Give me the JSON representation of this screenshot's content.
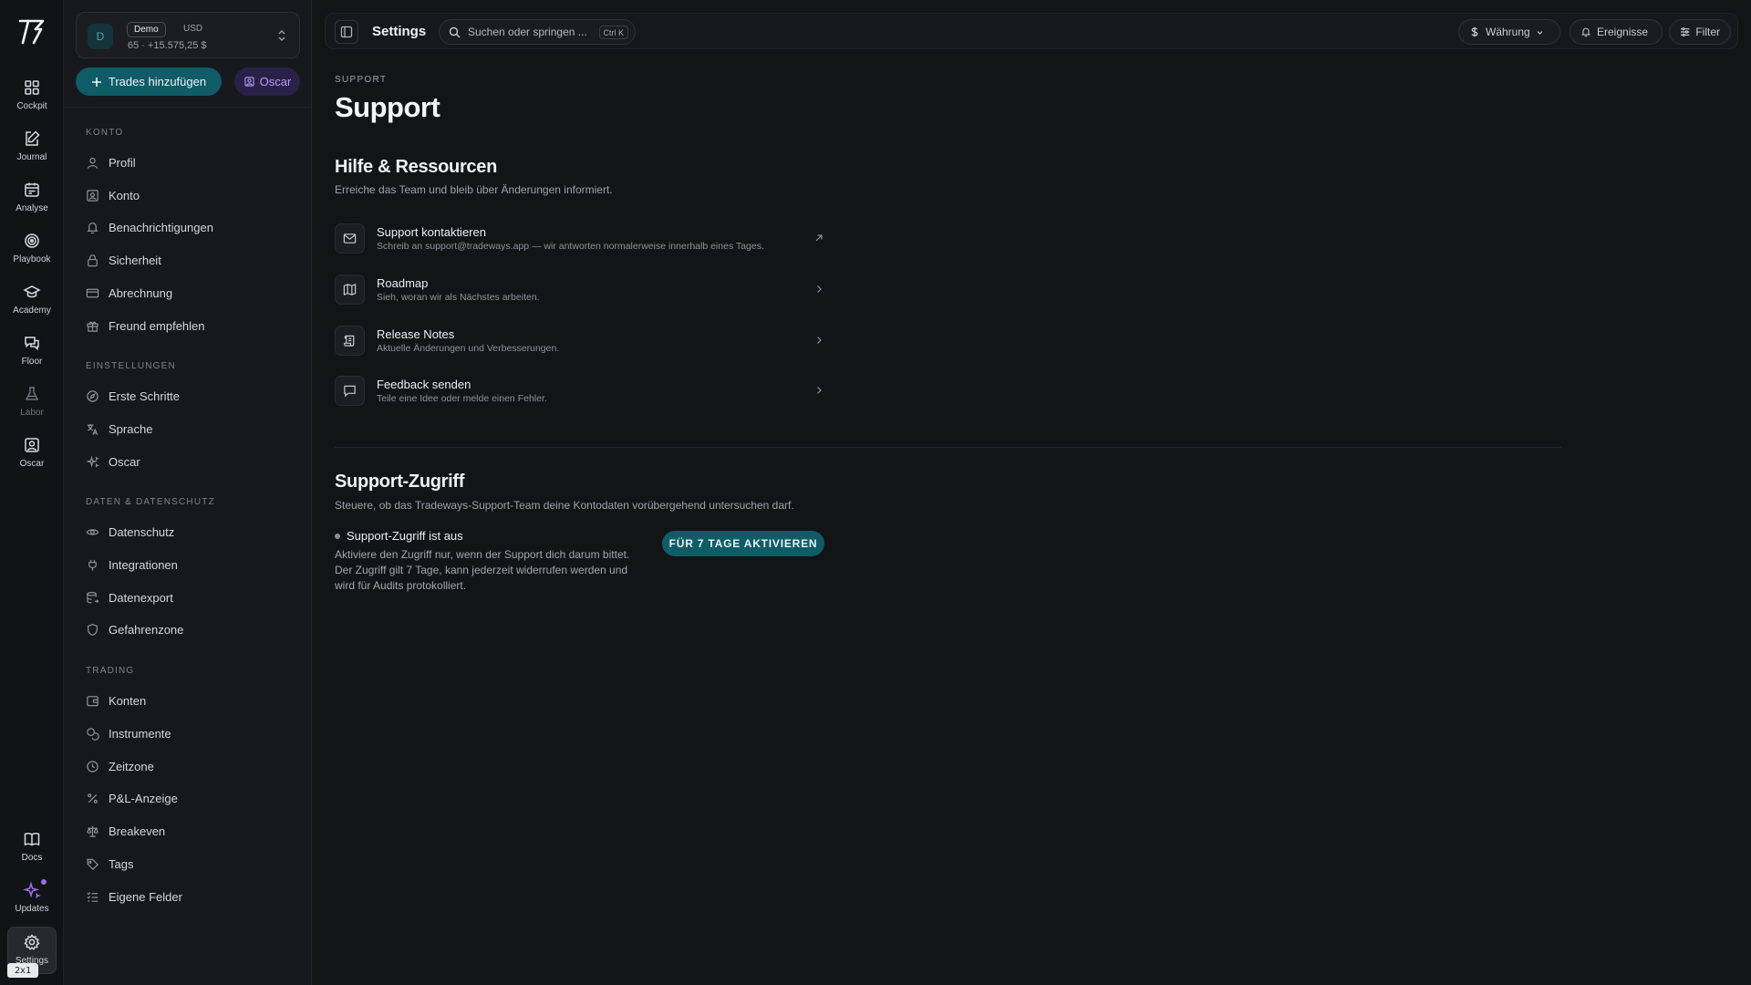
{
  "rail": {
    "items": [
      {
        "label": "Cockpit",
        "icon": "grid-icon"
      },
      {
        "label": "Journal",
        "icon": "edit-icon"
      },
      {
        "label": "Analyse",
        "icon": "calendar-icon"
      },
      {
        "label": "Playbook",
        "icon": "target-icon"
      },
      {
        "label": "Academy",
        "icon": "graduation-cap-icon"
      },
      {
        "label": "Floor",
        "icon": "chat-icon"
      },
      {
        "label": "Labor",
        "icon": "flask-icon"
      },
      {
        "label": "Oscar",
        "icon": "user-square-icon"
      }
    ],
    "bottom": [
      {
        "label": "Docs",
        "icon": "book-icon"
      },
      {
        "label": "Updates",
        "icon": "sparkle-icon"
      },
      {
        "label": "Settings",
        "icon": "gear-icon"
      }
    ],
    "overlay_badge": "2x1"
  },
  "account": {
    "avatar": "D",
    "badge": "Demo",
    "currency": "USD",
    "summary": "65 · +15.575,25 $"
  },
  "actions": {
    "add_trades": "Trades hinzufügen",
    "oscar": "Oscar"
  },
  "sidebar": {
    "sections": [
      {
        "title": "KONTO",
        "items": [
          "Profil",
          "Konto",
          "Benachrichtigungen",
          "Sicherheit",
          "Abrechnung",
          "Freund empfehlen"
        ]
      },
      {
        "title": "EINSTELLUNGEN",
        "items": [
          "Erste Schritte",
          "Sprache",
          "Oscar"
        ]
      },
      {
        "title": "DATEN & DATENSCHUTZ",
        "items": [
          "Datenschutz",
          "Integrationen",
          "Datenexport",
          "Gefahrenzone"
        ]
      },
      {
        "title": "TRADING",
        "items": [
          "Konten",
          "Instrumente",
          "Zeitzone",
          "P&L-Anzeige",
          "Breakeven",
          "Tags",
          "Eigene Felder"
        ]
      }
    ]
  },
  "topbar": {
    "title": "Settings",
    "search_placeholder": "Suchen oder springen ...",
    "shortcut": "Ctrl K",
    "currency_label": "Währung",
    "events_label": "Ereignisse",
    "filter_label": "Filter"
  },
  "page": {
    "eyebrow": "SUPPORT",
    "title": "Support",
    "resources": {
      "title": "Hilfe & Ressourcen",
      "description": "Erreiche das Team und bleib über Änderungen informiert.",
      "items": [
        {
          "title": "Support kontaktieren",
          "subtitle": "Schreib an support@tradeways.app — wir antworten normalerweise innerhalb eines Tages.",
          "icon": "mail-icon",
          "arrow": "external-link-icon"
        },
        {
          "title": "Roadmap",
          "subtitle": "Sieh, woran wir als Nächstes arbeiten.",
          "icon": "map-icon",
          "arrow": "chevron-right-icon"
        },
        {
          "title": "Release Notes",
          "subtitle": "Aktuelle Änderungen und Verbesserungen.",
          "icon": "scroll-icon",
          "arrow": "chevron-right-icon"
        },
        {
          "title": "Feedback senden",
          "subtitle": "Teile eine Idee oder melde einen Fehler.",
          "icon": "message-icon",
          "arrow": "chevron-right-icon"
        }
      ]
    },
    "access": {
      "title": "Support-Zugriff",
      "description": "Steuere, ob das Tradeways-Support-Team deine Kontodaten vorübergehend untersuchen darf.",
      "status": "Support-Zugriff ist aus",
      "detail": "Aktiviere den Zugriff nur, wenn der Support dich darum bittet. Der Zugriff gilt 7 Tage, kann jederzeit widerrufen werden und wird für Audits protokolliert.",
      "button": "FÜR 7 TAGE AKTIVIEREN"
    }
  },
  "colors": {
    "accent": "#0f5b66",
    "oscar": "#b89bf5",
    "background": "#131416"
  }
}
